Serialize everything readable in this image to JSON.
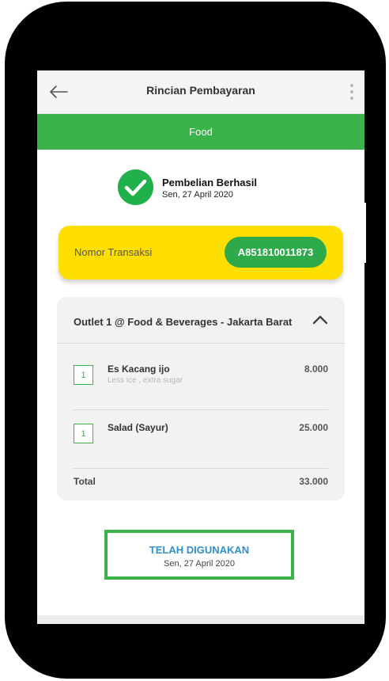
{
  "header": {
    "title": "Rincian Pembayaran"
  },
  "category": {
    "label": "Food"
  },
  "status": {
    "title": "Pembelian Berhasil",
    "date": "Sen, 27 April 2020"
  },
  "transaction": {
    "label": "Nomor Transaksi",
    "number": "A851810011873"
  },
  "order": {
    "outlet": "Outlet 1 @ Food & Beverages - Jakarta Barat",
    "items": [
      {
        "qty": "1",
        "name": "Es Kacang ijo",
        "note": "Less ice , extra sugar",
        "price": "8.000"
      },
      {
        "qty": "1",
        "name": "Salad (Sayur)",
        "note": "",
        "price": "25.000"
      }
    ],
    "total_label": "Total",
    "total_value": "33.000"
  },
  "stamp": {
    "title": "TELAH DIGUNAKAN",
    "date": "Sen, 27 April 2020"
  },
  "colors": {
    "green": "#39b34a",
    "yellow": "#ffdf00",
    "stamp_text": "#2f8fc7"
  },
  "icons": {
    "back": "arrow-left-icon",
    "menu": "more-vertical-icon",
    "success": "check-circle-icon",
    "collapse": "chevron-up-icon"
  }
}
